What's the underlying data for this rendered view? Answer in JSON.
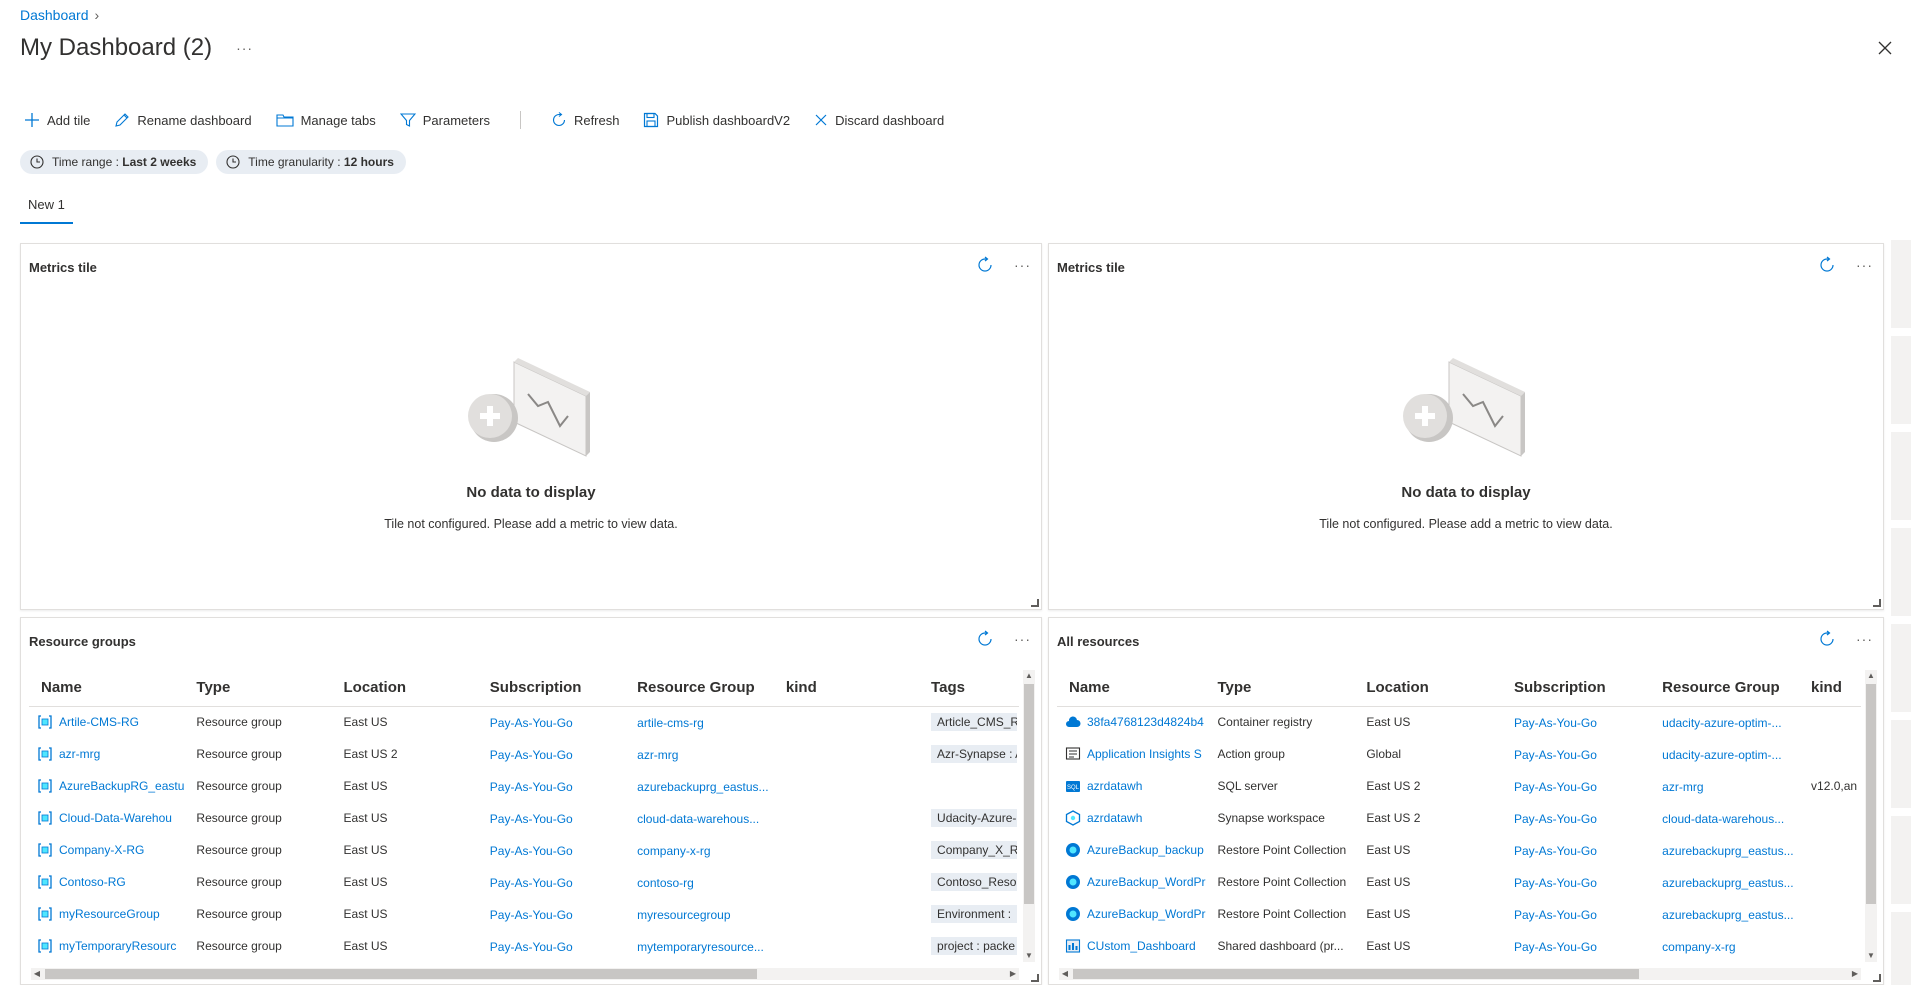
{
  "breadcrumb": {
    "root": "Dashboard"
  },
  "page": {
    "title": "My Dashboard (2)",
    "more": "···"
  },
  "toolbar": {
    "add_tile": "Add tile",
    "rename": "Rename dashboard",
    "manage_tabs": "Manage tabs",
    "parameters": "Parameters",
    "refresh": "Refresh",
    "publish": "Publish dashboardV2",
    "discard": "Discard dashboard"
  },
  "pills": {
    "time_range_label": "Time range : ",
    "time_range_value": "Last 2 weeks",
    "granularity_label": "Time granularity : ",
    "granularity_value": "12 hours"
  },
  "tabs": [
    "New 1"
  ],
  "metrics_tiles": [
    {
      "title": "Metrics tile",
      "empty_heading": "No data to display",
      "empty_text": "Tile not configured. Please add a metric to view data."
    },
    {
      "title": "Metrics tile",
      "empty_heading": "No data to display",
      "empty_text": "Tile not configured. Please add a metric to view data."
    }
  ],
  "resource_groups": {
    "title": "Resource groups",
    "columns": [
      "Name",
      "Type",
      "Location",
      "Subscription",
      "Resource Group",
      "kind",
      "Tags"
    ],
    "rows": [
      {
        "name": "Artile-CMS-RG",
        "type": "Resource group",
        "location": "East US",
        "subscription": "Pay-As-You-Go",
        "rg": "artile-cms-rg",
        "kind": "",
        "tag": "Article_CMS_R"
      },
      {
        "name": "azr-mrg",
        "type": "Resource group",
        "location": "East US 2",
        "subscription": "Pay-As-You-Go",
        "rg": "azr-mrg",
        "kind": "",
        "tag": "Azr-Synapse : A"
      },
      {
        "name": "AzureBackupRG_eastu",
        "type": "Resource group",
        "location": "East US",
        "subscription": "Pay-As-You-Go",
        "rg": "azurebackuprg_eastus...",
        "kind": "",
        "tag": ""
      },
      {
        "name": "Cloud-Data-Warehou",
        "type": "Resource group",
        "location": "East US",
        "subscription": "Pay-As-You-Go",
        "rg": "cloud-data-warehous...",
        "kind": "",
        "tag": "Udacity-Azure-"
      },
      {
        "name": "Company-X-RG",
        "type": "Resource group",
        "location": "East US",
        "subscription": "Pay-As-You-Go",
        "rg": "company-x-rg",
        "kind": "",
        "tag": "Company_X_RG"
      },
      {
        "name": "Contoso-RG",
        "type": "Resource group",
        "location": "East US",
        "subscription": "Pay-As-You-Go",
        "rg": "contoso-rg",
        "kind": "",
        "tag": "Contoso_Resou"
      },
      {
        "name": "myResourceGroup",
        "type": "Resource group",
        "location": "East US",
        "subscription": "Pay-As-You-Go",
        "rg": "myresourcegroup",
        "kind": "",
        "tag": "Environment :"
      },
      {
        "name": "myTemporaryResourc",
        "type": "Resource group",
        "location": "East US",
        "subscription": "Pay-As-You-Go",
        "rg": "mytemporaryresource...",
        "kind": "",
        "tag": "project : packe"
      }
    ]
  },
  "all_resources": {
    "title": "All resources",
    "columns": [
      "Name",
      "Type",
      "Location",
      "Subscription",
      "Resource Group",
      "kind"
    ],
    "rows": [
      {
        "icon": "cloud-icon",
        "name": "38fa4768123d4824b4",
        "type": "Container registry",
        "location": "East US",
        "subscription": "Pay-As-You-Go",
        "rg": "udacity-azure-optim-...",
        "kind": ""
      },
      {
        "icon": "monitor-icon",
        "name": "Application Insights S",
        "type": "Action group",
        "location": "Global",
        "subscription": "Pay-As-You-Go",
        "rg": "udacity-azure-optim-...",
        "kind": ""
      },
      {
        "icon": "sql-icon",
        "name": "azrdatawh",
        "type": "SQL server",
        "location": "East US 2",
        "subscription": "Pay-As-You-Go",
        "rg": "azr-mrg",
        "kind": "v12.0,an"
      },
      {
        "icon": "synapse-icon",
        "name": "azrdatawh",
        "type": "Synapse workspace",
        "location": "East US 2",
        "subscription": "Pay-As-You-Go",
        "rg": "cloud-data-warehous...",
        "kind": ""
      },
      {
        "icon": "restore-icon",
        "name": "AzureBackup_backup",
        "type": "Restore Point Collection",
        "location": "East US",
        "subscription": "Pay-As-You-Go",
        "rg": "azurebackuprg_eastus...",
        "kind": ""
      },
      {
        "icon": "restore-icon",
        "name": "AzureBackup_WordPr",
        "type": "Restore Point Collection",
        "location": "East US",
        "subscription": "Pay-As-You-Go",
        "rg": "azurebackuprg_eastus...",
        "kind": ""
      },
      {
        "icon": "restore-icon",
        "name": "AzureBackup_WordPr",
        "type": "Restore Point Collection",
        "location": "East US",
        "subscription": "Pay-As-You-Go",
        "rg": "azurebackuprg_eastus...",
        "kind": ""
      },
      {
        "icon": "dashboard-icon",
        "name": "CUstom_Dashboard",
        "type": "Shared dashboard (pr...",
        "location": "East US",
        "subscription": "Pay-As-You-Go",
        "rg": "company-x-rg",
        "kind": ""
      }
    ]
  },
  "colors": {
    "accent": "#0078d4",
    "pill_bg": "#e8edf3",
    "border": "#e1dfdd"
  }
}
